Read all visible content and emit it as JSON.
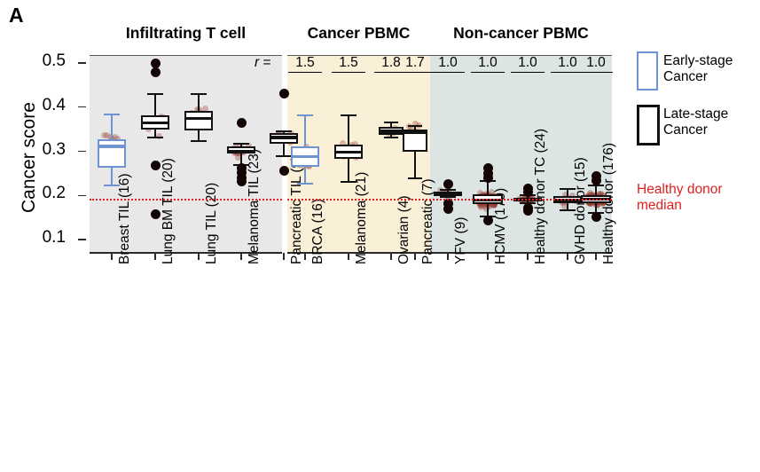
{
  "figure": {
    "panel_letter": "A",
    "y_axis_title": "Cancer score",
    "r_prefix": "r =",
    "colors": {
      "panel_infiltrating_bg": "#e8e8e8",
      "panel_cancer_pbmc_bg": "#faf0d7",
      "panel_noncancer_pbmc_bg": "#dce5e3",
      "early_stage": "#6f93d0",
      "late_stage": "#111111",
      "healthy_median_line": "#e02020",
      "jitter_point": "#96463299"
    }
  },
  "groups": [
    {
      "title": "Infiltrating T cell",
      "bg": "#e8e8e8"
    },
    {
      "title": "Cancer PBMC",
      "bg": "#faf0d7"
    },
    {
      "title": "Non-cancer PBMC",
      "bg": "#dce5e3"
    }
  ],
  "legend": {
    "items": [
      {
        "name": "early-stage",
        "label": "Early-stage\nCancer",
        "color": "#6f93d0"
      },
      {
        "name": "late-stage",
        "label": "Late-stage\nCancer",
        "color": "#111111"
      }
    ],
    "note": "Healthy donor\nmedian"
  },
  "chart_data": {
    "type": "box",
    "title": "",
    "xlabel": "",
    "ylabel": "Cancer score",
    "ylim": [
      0.1,
      0.52
    ],
    "yticks": [
      "0.5",
      "0.4",
      "0.3",
      "0.2",
      "0.1"
    ],
    "ytickvals": [
      0.5,
      0.4,
      0.3,
      0.2,
      0.1
    ],
    "grid": false,
    "legend_position": "right",
    "reference_line": {
      "label": "Healthy donor median",
      "value": 0.192,
      "color": "#e02020",
      "style": "dotted"
    },
    "annotation_row": {
      "prefix": "r =",
      "values": [
        "",
        "",
        "",
        "",
        "",
        "1.5",
        "1.5",
        "1.8",
        "1.7",
        "1.0",
        "1.0",
        "1.0",
        "1.0",
        ""
      ]
    },
    "categories": [
      "Breast TIL (16)",
      "Lung BM TIL (20)",
      "Lung TIL (20)",
      "Melanoma TIL (23)",
      "Pancreatic TIL (9)",
      "BRCA (16)",
      "Melanoma (21)",
      "Ovarian (4)",
      "Pancreatic (7)",
      "YFV (9)",
      "HCMV (179)",
      "Healthy donor TC (24)",
      "GVHD donor (15)",
      "Healthy donor (176)"
    ],
    "series": [
      {
        "name": "Breast TIL (16)",
        "group": "Infiltrating T cell",
        "stage": "early-stage",
        "n": 16,
        "r": null,
        "q1": 0.262,
        "median": 0.311,
        "q3": 0.327,
        "whisker_low": 0.222,
        "whisker_high": 0.383,
        "outliers": []
      },
      {
        "name": "Lung BM TIL (20)",
        "group": "Infiltrating T cell",
        "stage": "late-stage",
        "n": 20,
        "r": null,
        "q1": 0.349,
        "median": 0.364,
        "q3": 0.382,
        "whisker_low": 0.331,
        "whisker_high": 0.43,
        "outliers": [
          0.499,
          0.479,
          0.268,
          0.158
        ]
      },
      {
        "name": "Lung TIL (20)",
        "group": "Infiltrating T cell",
        "stage": "late-stage",
        "n": 20,
        "r": null,
        "q1": 0.347,
        "median": 0.374,
        "q3": 0.391,
        "whisker_low": 0.324,
        "whisker_high": 0.43,
        "outliers": []
      },
      {
        "name": "Melanoma TIL (23)",
        "group": "Infiltrating T cell",
        "stage": "late-stage",
        "n": 23,
        "r": null,
        "q1": 0.294,
        "median": 0.3,
        "q3": 0.311,
        "whisker_low": 0.268,
        "whisker_high": 0.318,
        "outliers": [
          0.364,
          0.262,
          0.251,
          0.24,
          0.232
        ]
      },
      {
        "name": "Pancreatic TIL (9)",
        "group": "Infiltrating T cell",
        "stage": "late-stage",
        "n": 9,
        "r": null,
        "q1": 0.318,
        "median": 0.331,
        "q3": 0.342,
        "whisker_low": 0.289,
        "whisker_high": 0.345,
        "outliers": [
          0.43,
          0.255
        ]
      },
      {
        "name": "BRCA (16)",
        "group": "Cancer PBMC",
        "stage": "early-stage",
        "n": 16,
        "r": 1.5,
        "q1": 0.264,
        "median": 0.288,
        "q3": 0.311,
        "whisker_low": 0.226,
        "whisker_high": 0.382,
        "outliers": []
      },
      {
        "name": "Melanoma (21)",
        "group": "Cancer PBMC",
        "stage": "late-stage",
        "n": 21,
        "r": 1.5,
        "q1": 0.283,
        "median": 0.298,
        "q3": 0.316,
        "whisker_low": 0.231,
        "whisker_high": 0.381,
        "outliers": []
      },
      {
        "name": "Ovarian (4)",
        "group": "Cancer PBMC",
        "stage": "late-stage",
        "n": 4,
        "r": 1.8,
        "q1": 0.337,
        "median": 0.345,
        "q3": 0.355,
        "whisker_low": 0.332,
        "whisker_high": 0.366,
        "outliers": []
      },
      {
        "name": "Pancreatic (7)",
        "group": "Cancer PBMC",
        "stage": "late-stage",
        "n": 7,
        "r": 1.7,
        "q1": 0.3,
        "median": 0.343,
        "q3": 0.35,
        "whisker_low": 0.239,
        "whisker_high": 0.358,
        "outliers": []
      },
      {
        "name": "YFV (9)",
        "group": "Non-cancer PBMC",
        "stage": "late-stage",
        "n": 9,
        "r": 1.0,
        "q1": 0.199,
        "median": 0.204,
        "q3": 0.209,
        "whisker_low": 0.197,
        "whisker_high": 0.212,
        "outliers": [
          0.226,
          0.181,
          0.169
        ]
      },
      {
        "name": "HCMV (179)",
        "group": "Non-cancer PBMC",
        "stage": "late-stage",
        "n": 179,
        "r": 1.0,
        "q1": 0.18,
        "median": 0.19,
        "q3": 0.202,
        "whisker_low": 0.152,
        "whisker_high": 0.233,
        "outliers": [
          0.262,
          0.25,
          0.24,
          0.143
        ]
      },
      {
        "name": "Healthy donor TC (24)",
        "group": "Non-cancer PBMC",
        "stage": "late-stage",
        "n": 24,
        "r": 1.0,
        "q1": 0.186,
        "median": 0.19,
        "q3": 0.195,
        "whisker_low": 0.182,
        "whisker_high": 0.2,
        "outliers": [
          0.216,
          0.208,
          0.172,
          0.165
        ]
      },
      {
        "name": "GVHD donor (15)",
        "group": "Non-cancer PBMC",
        "stage": "late-stage",
        "n": 15,
        "r": 1.0,
        "q1": 0.183,
        "median": 0.19,
        "q3": 0.199,
        "whisker_low": 0.166,
        "whisker_high": 0.215,
        "outliers": []
      },
      {
        "name": "Healthy donor (176)",
        "group": "Non-cancer PBMC",
        "stage": "late-stage",
        "n": 176,
        "r": 1.0,
        "q1": 0.182,
        "median": 0.191,
        "q3": 0.2,
        "whisker_low": 0.16,
        "whisker_high": 0.222,
        "outliers": [
          0.243,
          0.233,
          0.152
        ]
      }
    ]
  }
}
